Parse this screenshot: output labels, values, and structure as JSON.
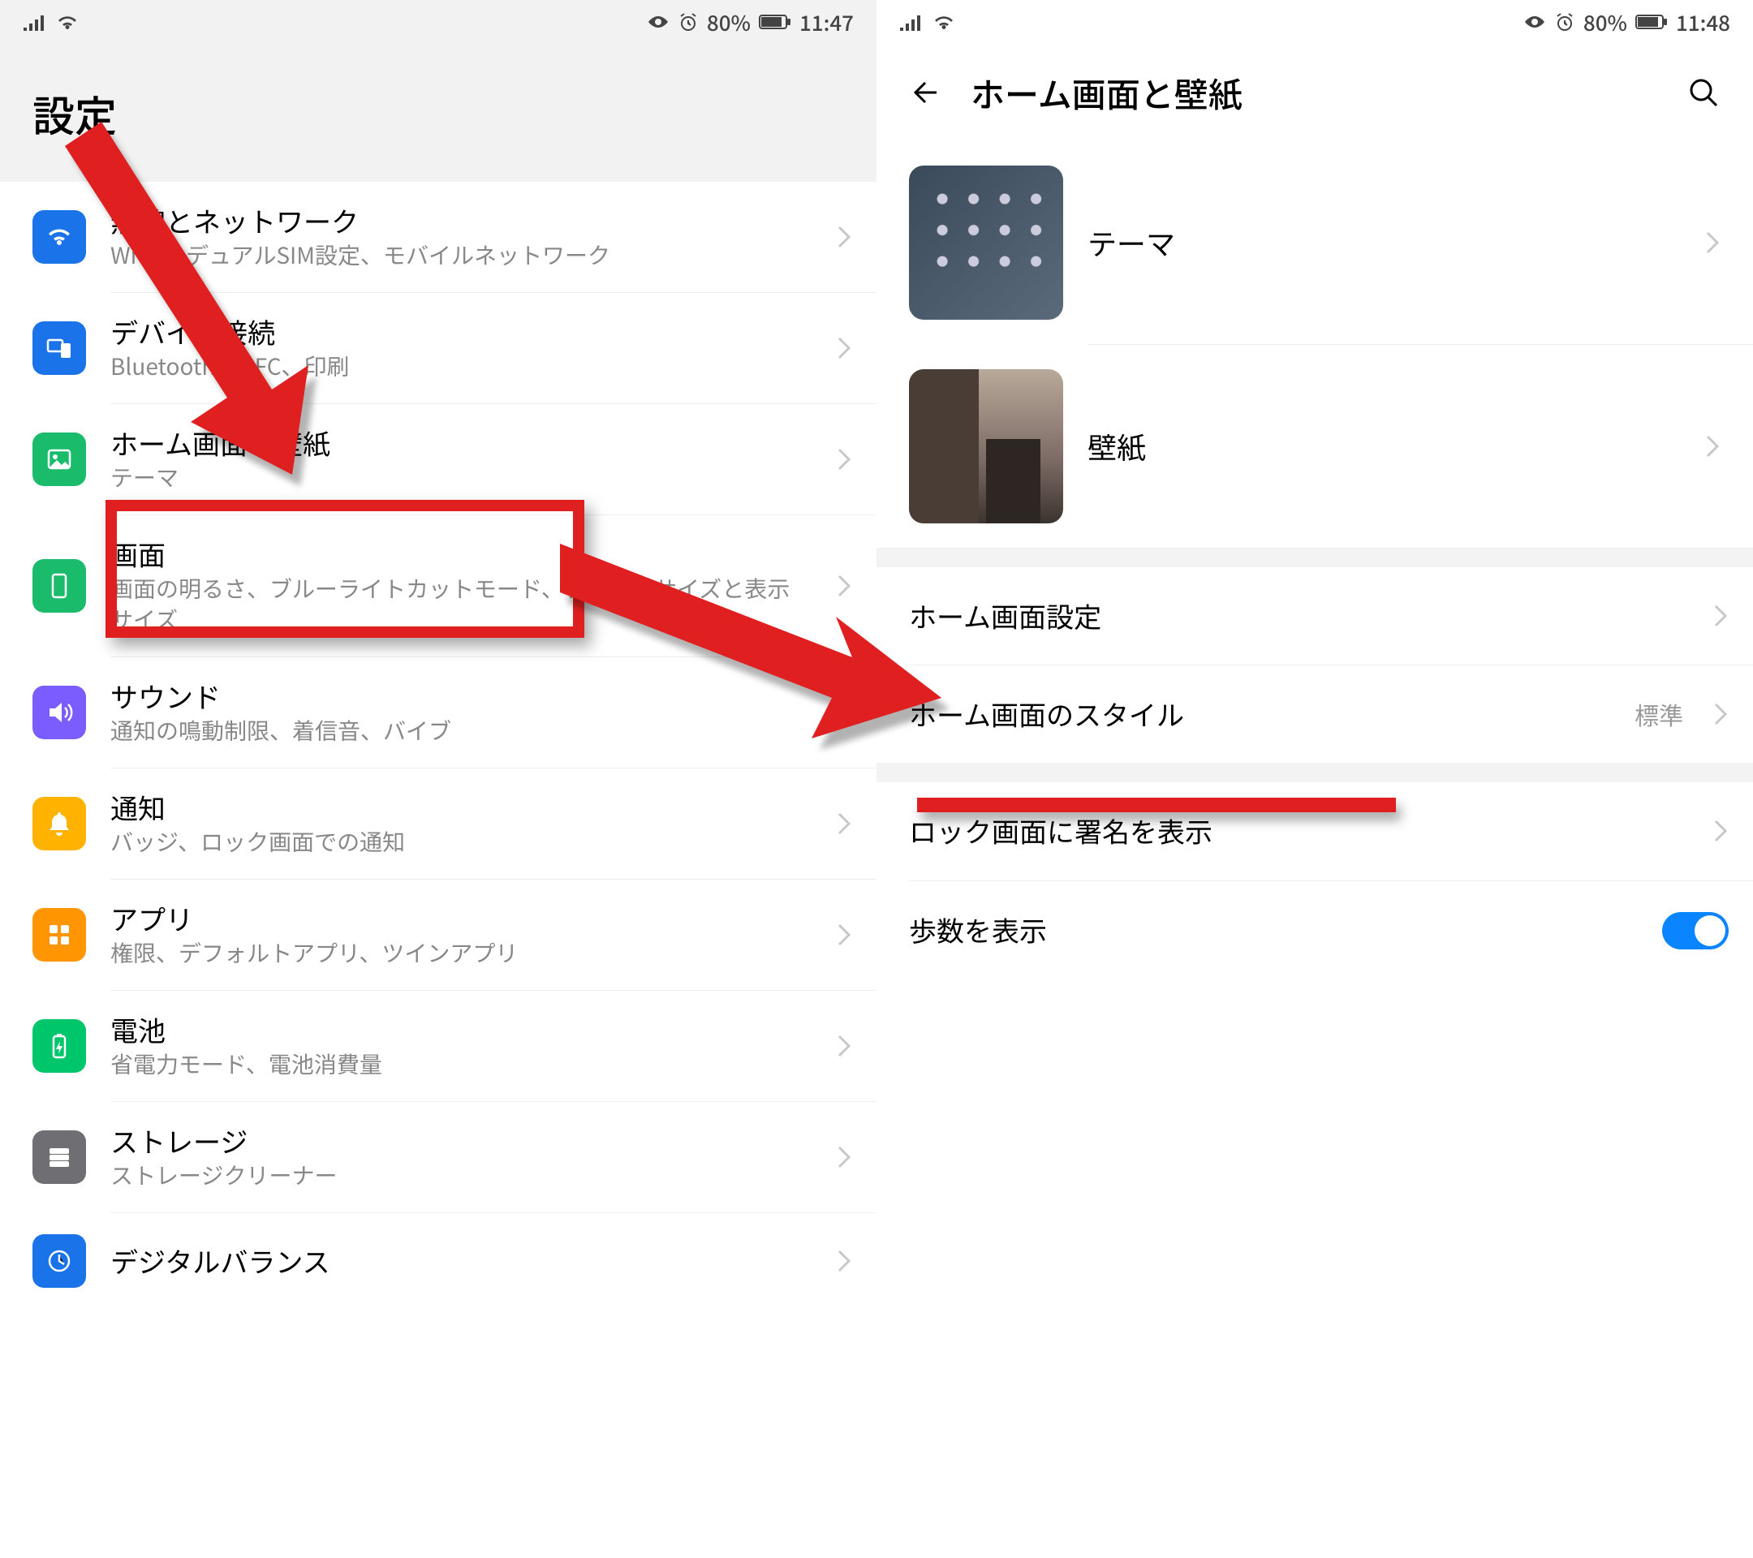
{
  "left": {
    "statusbar": {
      "battery": "80%",
      "time": "11:47"
    },
    "header": {
      "title": "設定"
    },
    "items": [
      {
        "icon": "wifi",
        "color": "#1a73e8",
        "title": "無線とネットワーク",
        "sub": "Wi-Fi、デュアルSIM設定、モバイルネットワーク"
      },
      {
        "icon": "device",
        "color": "#1a73e8",
        "title": "デバイス接続",
        "sub": "Bluetooth、NFC、印刷"
      },
      {
        "icon": "image",
        "color": "#1abc6b",
        "title": "ホーム画面と壁紙",
        "sub": "テーマ"
      },
      {
        "icon": "display",
        "color": "#1abc6b",
        "title": "画面",
        "sub": "画面の明るさ、ブルーライトカットモード、テキストサイズと表示サイズ"
      },
      {
        "icon": "sound",
        "color": "#7a5cff",
        "title": "サウンド",
        "sub": "通知の鳴動制限、着信音、バイブ"
      },
      {
        "icon": "bell",
        "color": "#ffb300",
        "title": "通知",
        "sub": "バッジ、ロック画面での通知"
      },
      {
        "icon": "apps",
        "color": "#ff9500",
        "title": "アプリ",
        "sub": "権限、デフォルトアプリ、ツインアプリ"
      },
      {
        "icon": "battery",
        "color": "#00c66b",
        "title": "電池",
        "sub": "省電力モード、電池消費量"
      },
      {
        "icon": "storage",
        "color": "#6e6e73",
        "title": "ストレージ",
        "sub": "ストレージクリーナー"
      },
      {
        "icon": "digital",
        "color": "#1a73e8",
        "title": "デジタルバランス",
        "sub": ""
      }
    ]
  },
  "right": {
    "statusbar": {
      "battery": "80%",
      "time": "11:48"
    },
    "header": {
      "title": "ホーム画面と壁紙"
    },
    "top_items": [
      {
        "thumb": "theme",
        "title": "テーマ"
      },
      {
        "thumb": "wall",
        "title": "壁紙"
      }
    ],
    "mid_items": [
      {
        "title": "ホーム画面設定",
        "value": ""
      },
      {
        "title": "ホーム画面のスタイル",
        "value": "標準"
      }
    ],
    "bottom_items": [
      {
        "title": "ロック画面に署名を表示",
        "type": "chev"
      },
      {
        "title": "歩数を表示",
        "type": "toggle",
        "on": true
      }
    ]
  }
}
